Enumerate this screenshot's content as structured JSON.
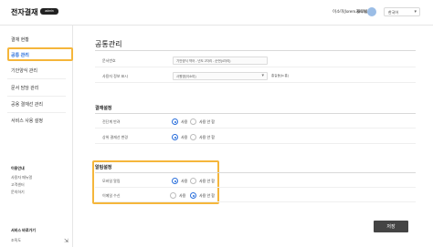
{
  "header": {
    "logo": "전자결재",
    "badge": "admin",
    "user_email": "이소미(lorem.ipsum)",
    "user_role": "재무팀",
    "language": "한국어"
  },
  "sidebar": {
    "items": [
      {
        "label": "결재 현황"
      },
      {
        "label": "공통 관리"
      },
      {
        "label": "기안양식 관리"
      },
      {
        "label": "문서 담당 관리"
      },
      {
        "label": "공용 결재선 관리"
      },
      {
        "label": "서비스 사용 설정"
      }
    ],
    "help_title": "이용안내",
    "help_links": [
      "사용자 매뉴얼",
      "고객센터",
      "문의하기"
    ],
    "shortcut_title": "서비스 바로가기",
    "shortcut_link": "조직도"
  },
  "main": {
    "title": "공통관리",
    "doc_number_label": "문서번호",
    "doc_number_value": "기안양식 약어 - 년도 2자리 - 순번(4자리)",
    "user_info_label": "사용자 정보 표시",
    "user_info_value": "사원명(이소미)",
    "user_info_extra": "홍길동(lo 홍)",
    "approval_section": "결재설정",
    "approval_rows": [
      {
        "label": "전단계 반려",
        "on_label": "사용",
        "off_label": "사용 안 함"
      },
      {
        "label": "상위 결재선 변경",
        "on_label": "사용",
        "off_label": "사용 안 함"
      }
    ],
    "alarm_section": "알림설정",
    "alarm_rows": [
      {
        "label": "모바일 알림",
        "on_label": "사용",
        "off_label": "사용 안 함"
      },
      {
        "label": "이메일 수신",
        "on_label": "사용",
        "off_label": "사용 안 함"
      }
    ],
    "save_label": "저장"
  },
  "colors": {
    "accent": "#2a6fdb",
    "highlight": "#f5b63b",
    "save_button": "#444444"
  }
}
